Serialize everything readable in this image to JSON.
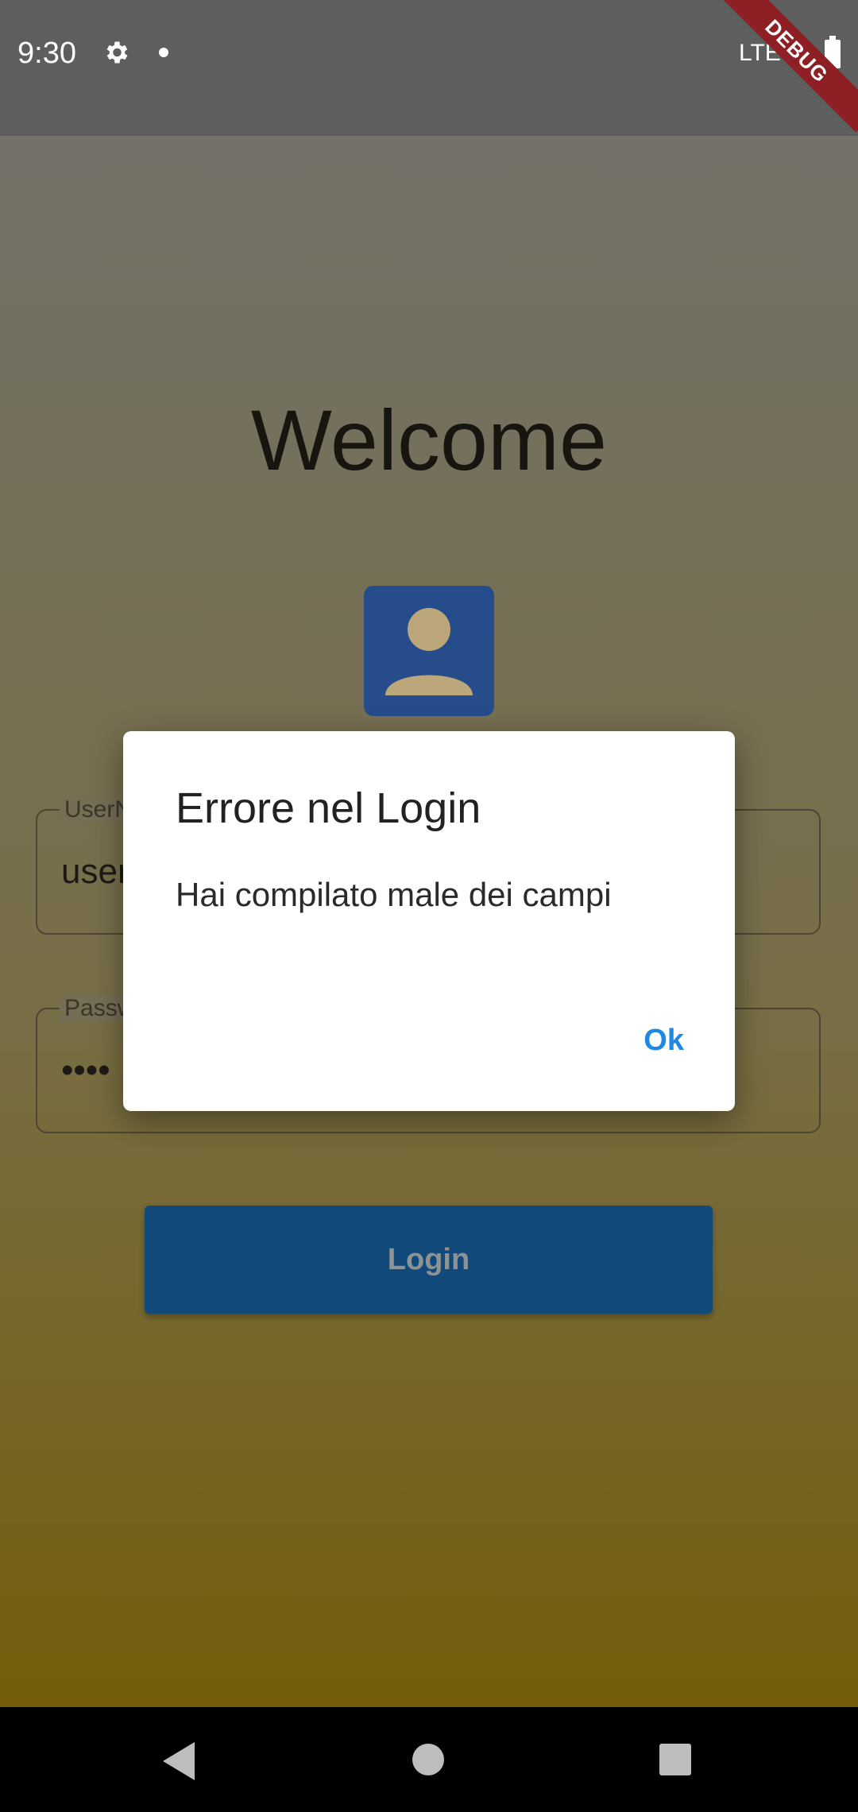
{
  "status_bar": {
    "time": "9:30",
    "network": "LTE",
    "debug_label": "DEBUG"
  },
  "app": {
    "welcome": "Welcome",
    "username_field": {
      "label": "UserName",
      "value": "user"
    },
    "password_field": {
      "label": "Password",
      "value": "••••"
    },
    "login_button": "Login"
  },
  "dialog": {
    "title": "Errore nel Login",
    "message": "Hai compilato male dei campi",
    "ok_label": "Ok"
  },
  "colors": {
    "dialog_action": "#1e88e5",
    "login_button": "#10497a",
    "avatar": "#264c8c"
  }
}
